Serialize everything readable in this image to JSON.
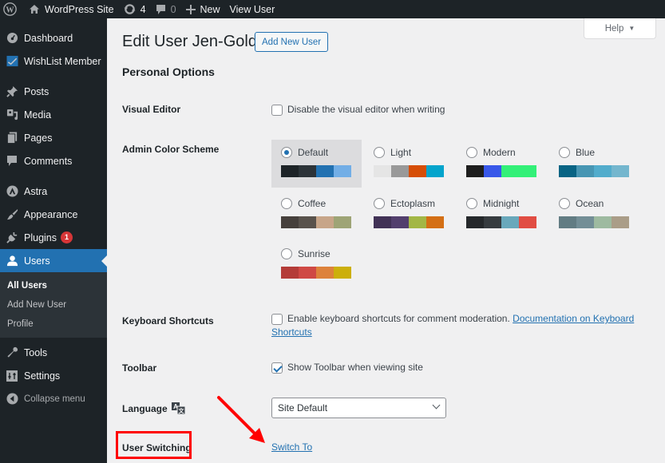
{
  "admin_bar": {
    "site_name": "WordPress Site",
    "updates_count": "4",
    "comments_count": "0",
    "new_label": "New",
    "view_user_label": "View User"
  },
  "sidebar": {
    "items": [
      {
        "label": "Dashboard",
        "icon": "dashboard-icon"
      },
      {
        "label": "WishList Member",
        "icon": "wishlist-icon"
      },
      {
        "label": "Posts",
        "icon": "pin-icon"
      },
      {
        "label": "Media",
        "icon": "media-icon"
      },
      {
        "label": "Pages",
        "icon": "pages-icon"
      },
      {
        "label": "Comments",
        "icon": "comment-icon"
      },
      {
        "label": "Astra",
        "icon": "astra-icon"
      },
      {
        "label": "Appearance",
        "icon": "brush-icon"
      },
      {
        "label": "Plugins",
        "icon": "plugin-icon",
        "badge": "1"
      },
      {
        "label": "Users",
        "icon": "user-icon"
      },
      {
        "label": "Tools",
        "icon": "wrench-icon"
      },
      {
        "label": "Settings",
        "icon": "settings-icon"
      }
    ],
    "users_submenu": [
      "All Users",
      "Add New User",
      "Profile"
    ],
    "collapse_label": "Collapse menu"
  },
  "page": {
    "title": "Edit User Jen-Gold",
    "add_new_label": "Add New User",
    "help_label": "Help",
    "section_title": "Personal Options"
  },
  "visual_editor": {
    "label": "Visual Editor",
    "checkbox_text": "Disable the visual editor when writing",
    "checked": false
  },
  "color_scheme": {
    "label": "Admin Color Scheme",
    "selected": "Default",
    "schemes": [
      {
        "name": "Default",
        "colors": [
          "#1d2327",
          "#2c3338",
          "#2271b1",
          "#72aee6"
        ]
      },
      {
        "name": "Light",
        "colors": [
          "#e5e5e5",
          "#999999",
          "#d64e07",
          "#04a4cc"
        ]
      },
      {
        "name": "Modern",
        "colors": [
          "#1e1e1e",
          "#3858e9",
          "#33f078",
          "#33f078"
        ]
      },
      {
        "name": "Blue",
        "colors": [
          "#096484",
          "#4796b3",
          "#52accc",
          "#74b6ce"
        ]
      },
      {
        "name": "Coffee",
        "colors": [
          "#46403c",
          "#59524c",
          "#c7a589",
          "#9ea476"
        ]
      },
      {
        "name": "Ectoplasm",
        "colors": [
          "#413256",
          "#523f6d",
          "#a3b745",
          "#d46f15"
        ]
      },
      {
        "name": "Midnight",
        "colors": [
          "#25282b",
          "#363b3f",
          "#69a8bb",
          "#e14d43"
        ]
      },
      {
        "name": "Ocean",
        "colors": [
          "#627c83",
          "#738e96",
          "#9ebaa0",
          "#aa9d88"
        ]
      },
      {
        "name": "Sunrise",
        "colors": [
          "#b43c38",
          "#cf4944",
          "#dd823b",
          "#ccaf0b"
        ]
      }
    ]
  },
  "keyboard_shortcuts": {
    "label": "Keyboard Shortcuts",
    "checkbox_text": "Enable keyboard shortcuts for comment moderation.",
    "link_text_1": "Documentation on Keyboard",
    "link_text_2": "Shortcuts",
    "checked": false
  },
  "toolbar": {
    "label": "Toolbar",
    "checkbox_text": "Show Toolbar when viewing site",
    "checked": true
  },
  "language": {
    "label": "Language",
    "selected": "Site Default"
  },
  "user_switching": {
    "label": "User Switching",
    "link_text": "Switch To"
  },
  "annotation": {
    "color": "#ff0000"
  }
}
